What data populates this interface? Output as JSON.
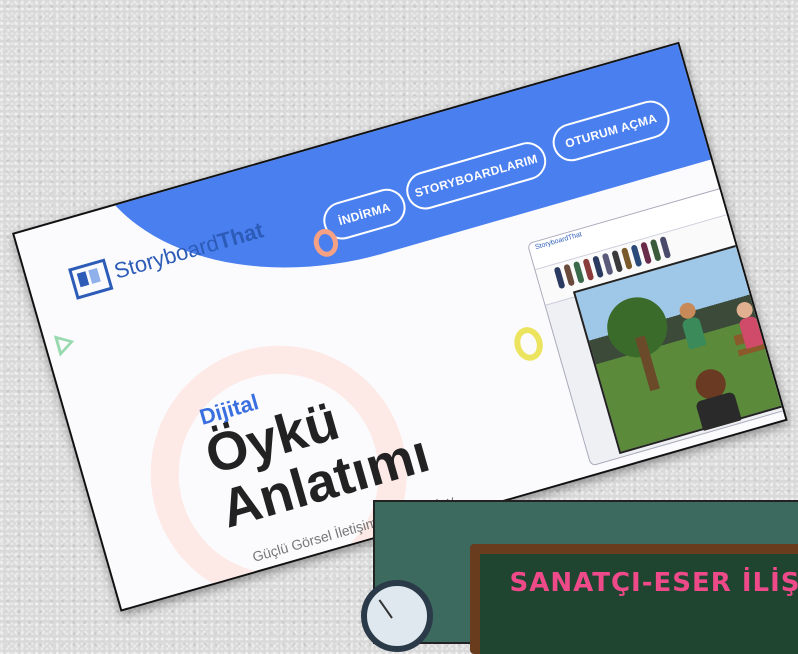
{
  "website": {
    "logo": {
      "text_regular": "Storyboard",
      "text_bold": "That"
    },
    "nav": [
      {
        "label": "İNDİRMA"
      },
      {
        "label": "STORYBOARDLARIM"
      },
      {
        "label": "OTURUM AÇMA"
      }
    ],
    "hero": {
      "eyebrow": "Dijital",
      "line1": "Öykü",
      "line2": "Anlatımı",
      "tagline": "Güçlü Görsel İletişim, Daha Kolay"
    },
    "app_preview": {
      "title": "StoryboardThat"
    }
  },
  "chalkboard": {
    "title": "SANATÇI-ESER İLİŞ"
  },
  "colors": {
    "brand_blue": "#4a7ff0",
    "logo_blue": "#2c5cb8",
    "board_text": "#ee4a8a"
  }
}
